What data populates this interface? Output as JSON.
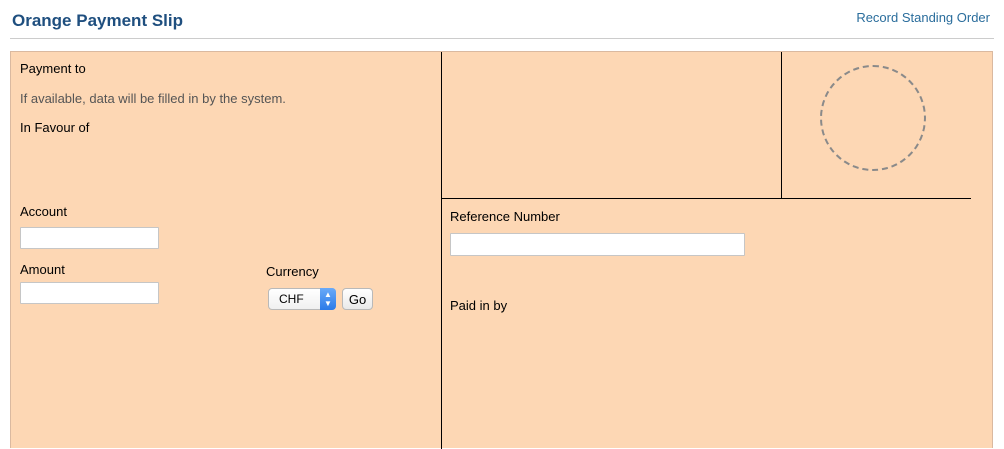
{
  "header": {
    "title": "Orange Payment Slip",
    "record_link": "Record Standing Order"
  },
  "payment_to": {
    "label": "Payment to",
    "hint": "If available, data will be filled in by the system.",
    "in_favour_label": "In Favour of"
  },
  "account": {
    "label": "Account",
    "value": ""
  },
  "amount": {
    "label": "Amount",
    "value": ""
  },
  "currency": {
    "label": "Currency",
    "selected": "CHF",
    "go_label": "Go"
  },
  "reference": {
    "label": "Reference Number",
    "value": ""
  },
  "paid_in_by": {
    "label": "Paid in by"
  },
  "colors": {
    "slip_bg": "#fdd7b4",
    "title": "#1f4f7f",
    "link": "#2a6d9c"
  }
}
